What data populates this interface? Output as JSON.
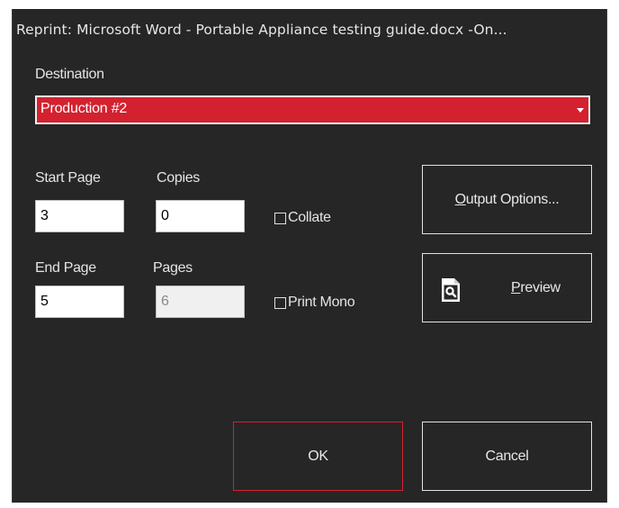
{
  "title": "Reprint:  Microsoft Word - Portable Appliance testing guide.docx  -On...",
  "destination": {
    "label": "Destination",
    "selected": "Production #2"
  },
  "start_page": {
    "label": "Start Page",
    "value": "3"
  },
  "copies": {
    "label": "Copies",
    "value": "0"
  },
  "end_page": {
    "label": "End Page",
    "value": "5"
  },
  "pages": {
    "label": "Pages",
    "value": "6"
  },
  "collate": {
    "label": "Collate",
    "checked": false
  },
  "print_mono": {
    "label": "Print Mono",
    "checked": false
  },
  "buttons": {
    "output_options": {
      "mnemonic": "O",
      "rest": "utput Options..."
    },
    "preview": {
      "mnemonic": "P",
      "rest": "review",
      "icon": "document-search-icon"
    },
    "ok": "OK",
    "cancel": "Cancel"
  },
  "colors": {
    "background": "#262626",
    "accent": "#d3212f",
    "text": "#e8e8e8"
  }
}
